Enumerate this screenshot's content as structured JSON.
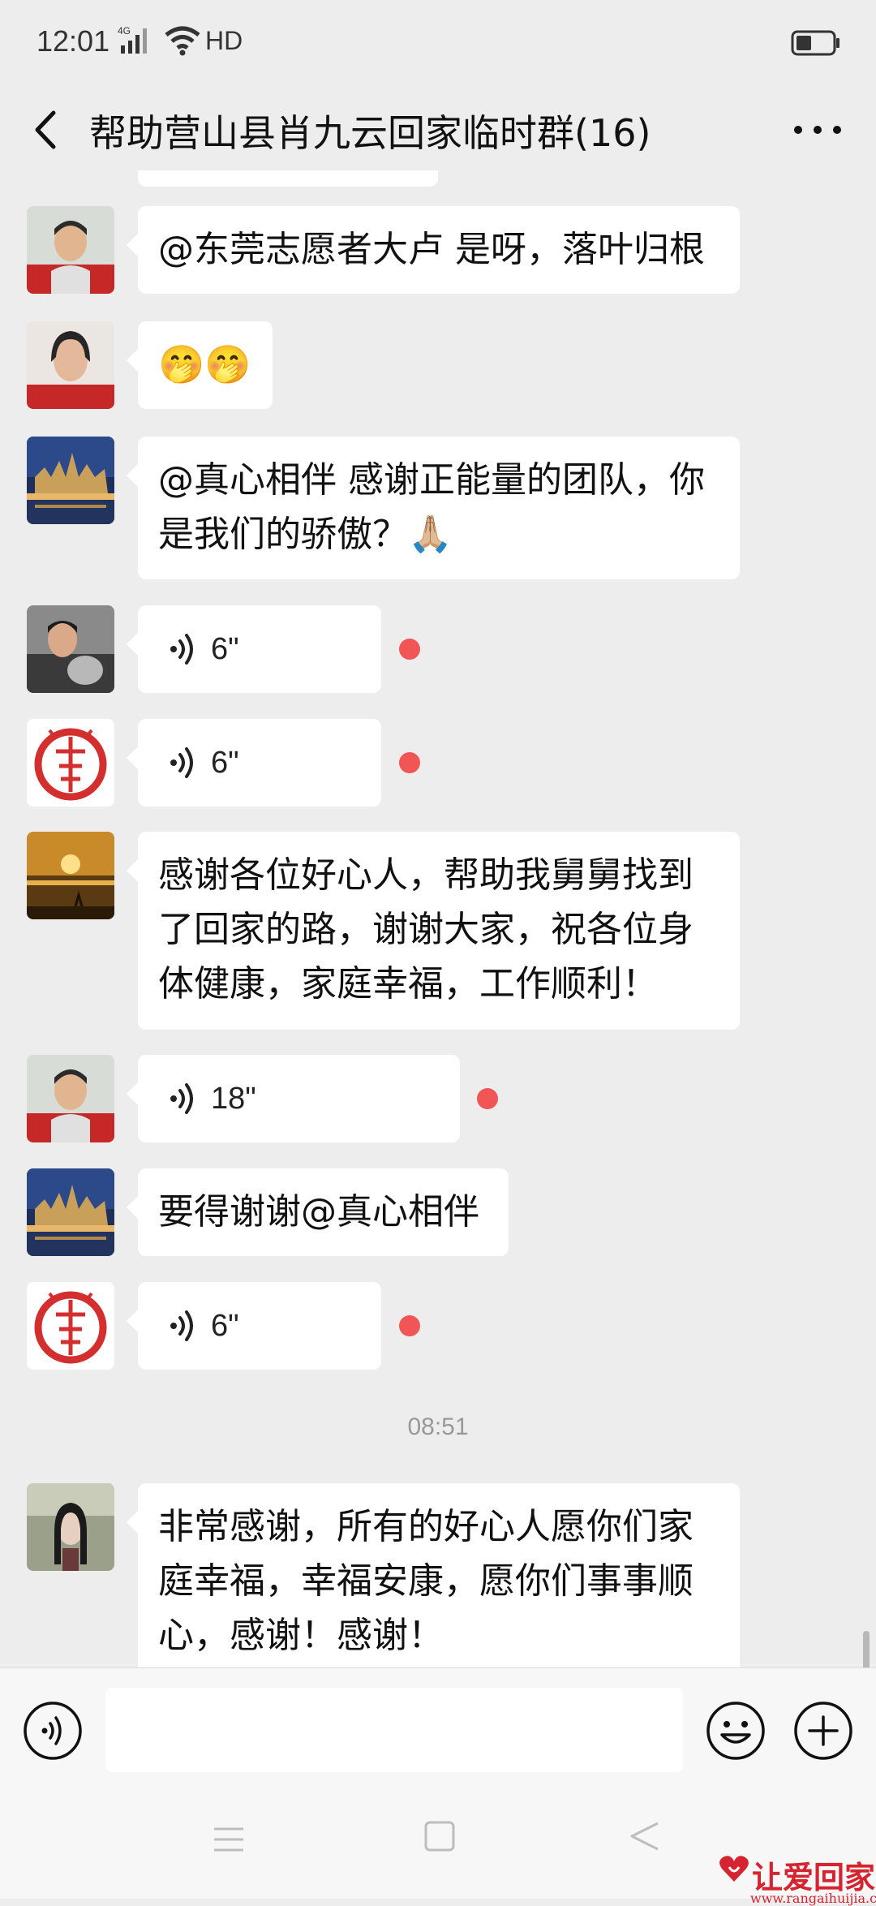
{
  "status_bar": {
    "time": "12:01",
    "network": "4G",
    "hd_label": "HD"
  },
  "header": {
    "title": "帮助营山县肖九云回家临时群(16)"
  },
  "messages": [
    {
      "type": "text",
      "lines": [
        "@东莞志愿者大卢  是呀，落叶归根"
      ]
    },
    {
      "type": "emoji",
      "emoji": "🤭🤭"
    },
    {
      "type": "text",
      "lines": [
        "@真心相伴  感谢正能量的团队，你",
        "是我们的骄傲？🙏🏼"
      ]
    },
    {
      "type": "voice",
      "duration": "6\"",
      "unread": true
    },
    {
      "type": "voice",
      "duration": "6\"",
      "unread": true
    },
    {
      "type": "text",
      "lines": [
        "感谢各位好心人，帮助我舅舅找到",
        "了回家的路，谢谢大家，祝各位身",
        "体健康，家庭幸福，工作顺利！"
      ]
    },
    {
      "type": "voice",
      "duration": "18\"",
      "unread": true
    },
    {
      "type": "text",
      "lines": [
        "要得谢谢@真心相伴"
      ]
    },
    {
      "type": "voice",
      "duration": "6\"",
      "unread": true
    },
    {
      "type": "timestamp",
      "text": "08:51"
    },
    {
      "type": "text",
      "lines": [
        "非常感谢，所有的好心人愿你们家",
        "庭幸福，幸福安康，愿你们事事顺",
        "心，感谢！感谢！"
      ]
    }
  ],
  "input": {
    "placeholder": ""
  },
  "watermark": {
    "brand": "让爱回家",
    "url": "www.rangaihuijia.com"
  },
  "colors": {
    "background": "#ededed",
    "bubble": "#ffffff",
    "unread_dot": "#f25555",
    "watermark": "#d5232f"
  }
}
